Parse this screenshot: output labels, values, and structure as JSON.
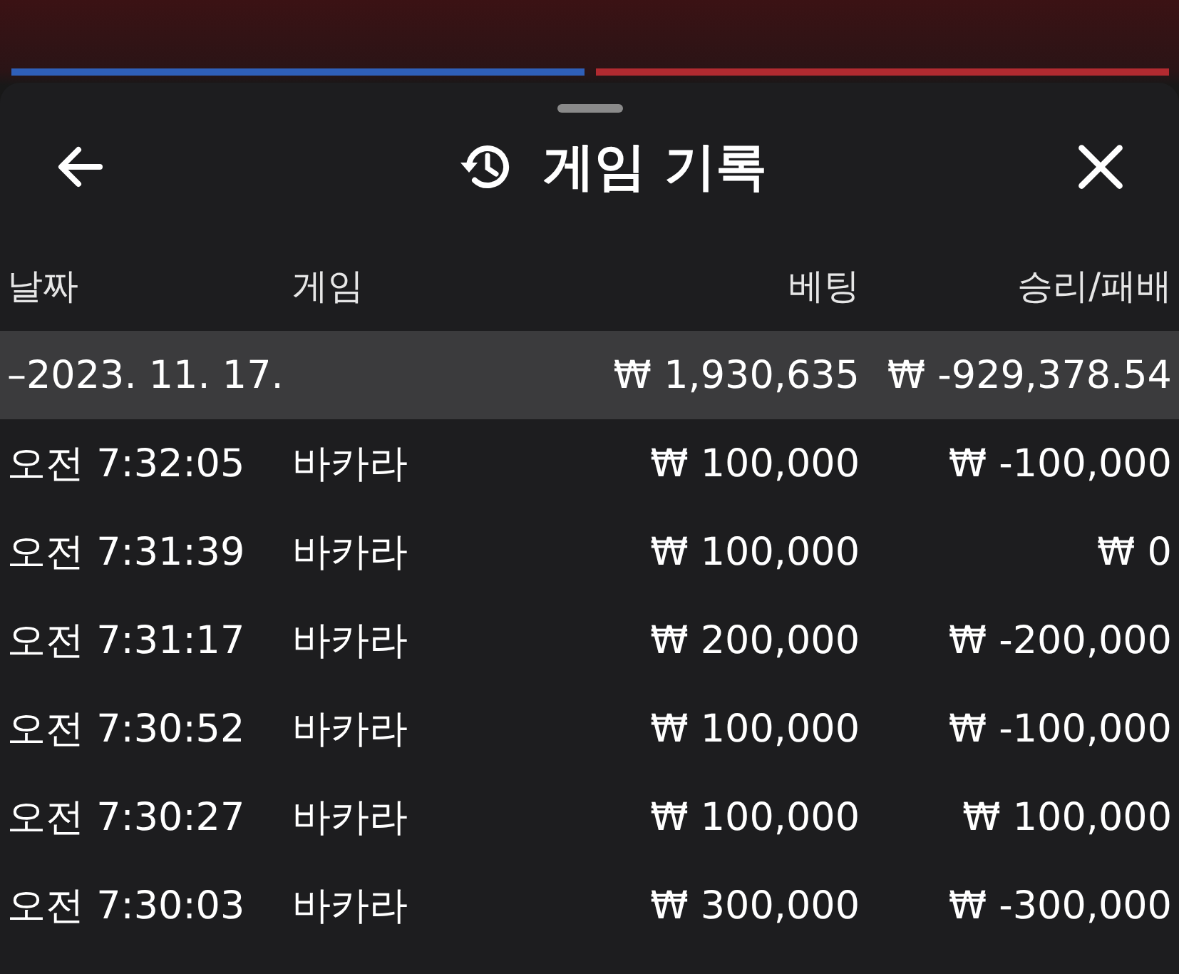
{
  "header": {
    "title": "게임 기록"
  },
  "columns": [
    "날짜",
    "게임",
    "베팅",
    "승리/패배"
  ],
  "summary": {
    "date": "–2023. 11. 17.",
    "bet": "₩ 1,930,635",
    "result": "₩ -929,378.54"
  },
  "rows": [
    {
      "time": "오전 7:32:05",
      "game": "바카라",
      "bet": "₩ 100,000",
      "result": "₩ -100,000"
    },
    {
      "time": "오전 7:31:39",
      "game": "바카라",
      "bet": "₩ 100,000",
      "result": "₩ 0"
    },
    {
      "time": "오전 7:31:17",
      "game": "바카라",
      "bet": "₩ 200,000",
      "result": "₩ -200,000"
    },
    {
      "time": "오전 7:30:52",
      "game": "바카라",
      "bet": "₩ 100,000",
      "result": "₩ -100,000"
    },
    {
      "time": "오전 7:30:27",
      "game": "바카라",
      "bet": "₩ 100,000",
      "result": "₩ 100,000"
    },
    {
      "time": "오전 7:30:03",
      "game": "바카라",
      "bet": "₩ 300,000",
      "result": "₩ -300,000"
    }
  ]
}
